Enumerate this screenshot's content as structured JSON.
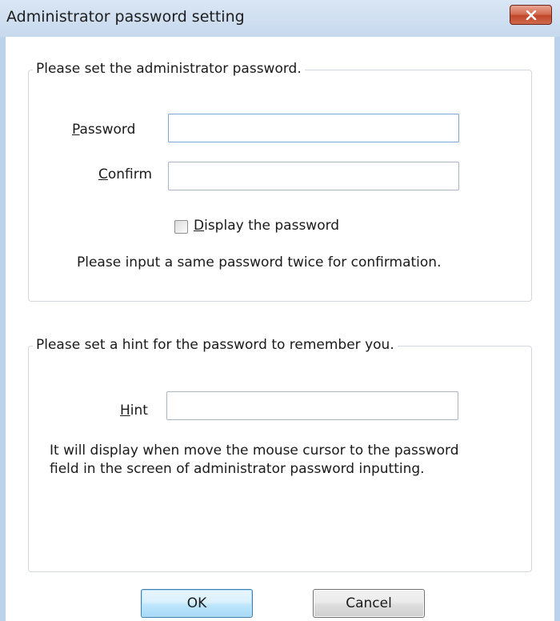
{
  "window": {
    "title": "Administrator password setting",
    "close_icon": "close-icon"
  },
  "password_group": {
    "legend": "Please set the administrator password.",
    "password_label_mnemonic": "P",
    "password_label_rest": "assword",
    "password_value": "",
    "confirm_label_mnemonic": "C",
    "confirm_label_rest": "onfirm",
    "confirm_value": "",
    "display_checkbox_mnemonic": "D",
    "display_checkbox_rest": "isplay the password",
    "display_checkbox_checked": false,
    "info": "Please input a same password twice for confirmation."
  },
  "hint_group": {
    "legend": "Please set a hint for the password to remember you.",
    "hint_label_mnemonic": "H",
    "hint_label_rest": "int",
    "hint_value": "",
    "info_line1": "It will display when move the mouse cursor to the password",
    "info_line2": "field in the screen of administrator password inputting."
  },
  "buttons": {
    "ok": "OK",
    "cancel": "Cancel"
  },
  "colors": {
    "titlebar": "#c7d9ee",
    "close_button": "#c2462a",
    "ok_button_border": "#3c7fb1"
  }
}
